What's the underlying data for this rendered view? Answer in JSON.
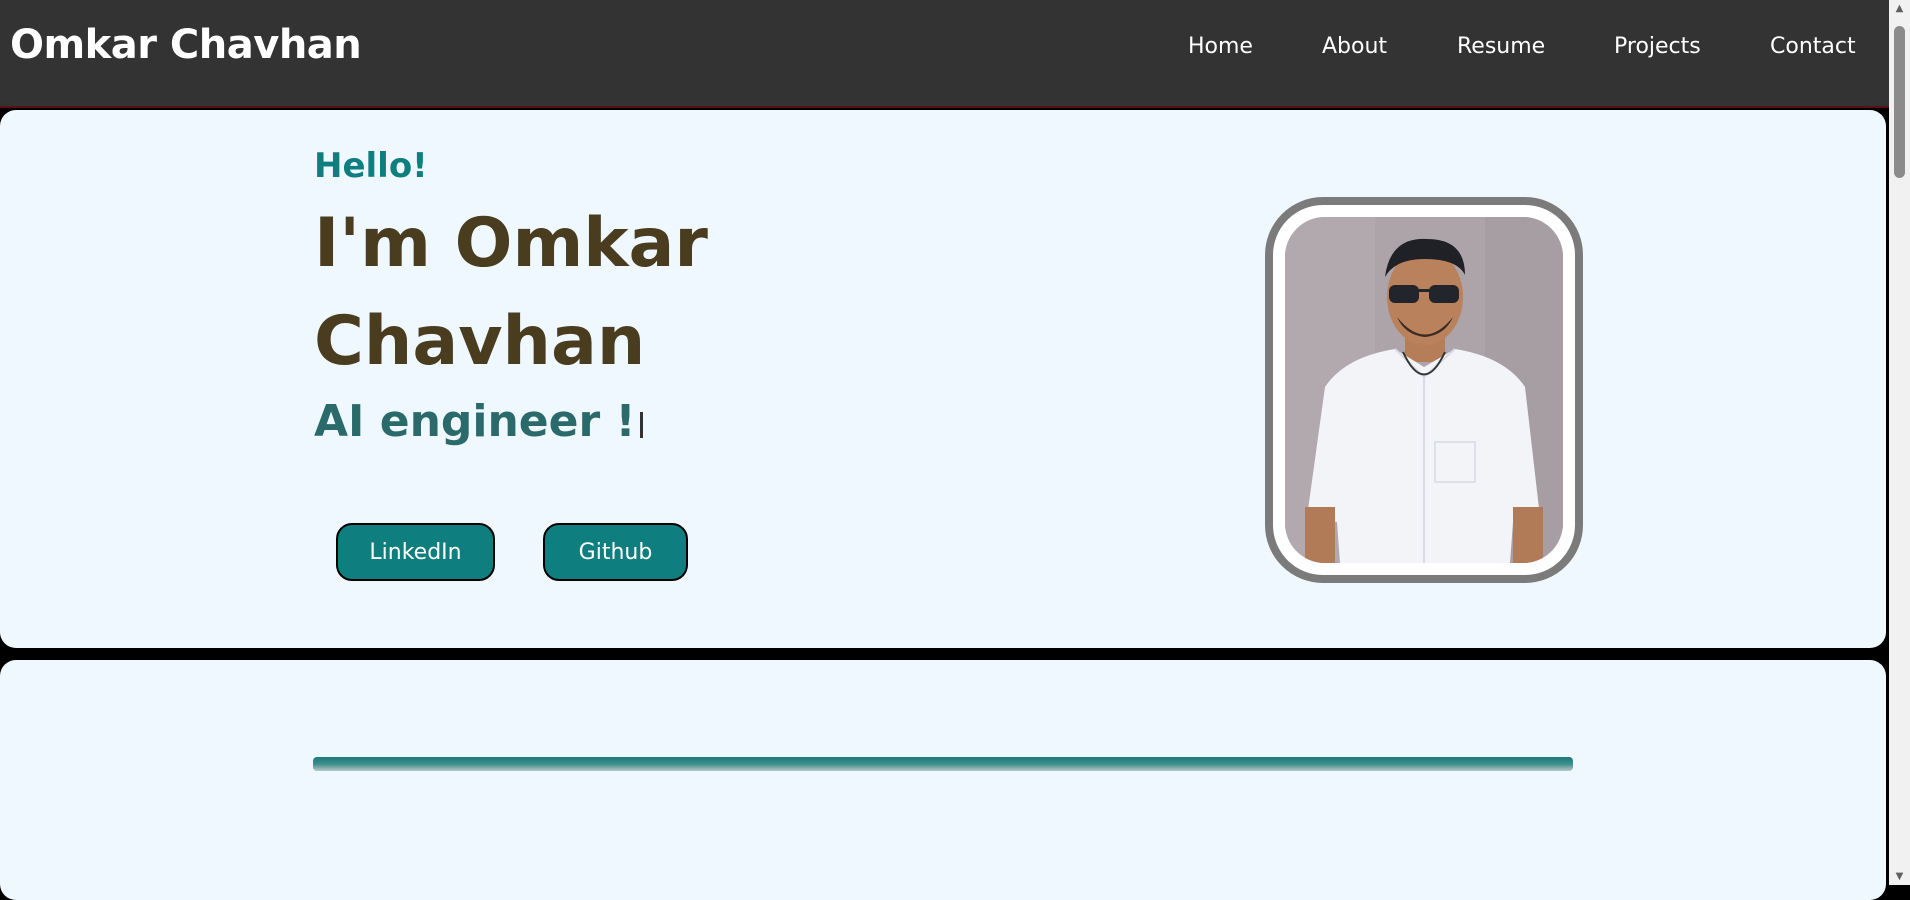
{
  "navbar": {
    "brand": "Omkar Chavhan",
    "links": [
      {
        "label": "Home"
      },
      {
        "label": "About"
      },
      {
        "label": "Resume"
      },
      {
        "label": "Projects"
      },
      {
        "label": "Contact"
      }
    ]
  },
  "hero": {
    "greeting": "Hello!",
    "name_line1": "I'm Omkar",
    "name_line2": "Chavhan",
    "role": "AI engineer !",
    "buttons": {
      "linkedin": "LinkedIn",
      "github": "Github"
    },
    "photo": {
      "subject": "profile-photo of man in white shirt and sunglasses"
    }
  },
  "colors": {
    "navbar_bg": "#333333",
    "card_bg": "#eff8fe",
    "accent_teal": "#0e7e7e",
    "name_color": "#4a3c1f",
    "role_color": "#2a6a6a"
  }
}
